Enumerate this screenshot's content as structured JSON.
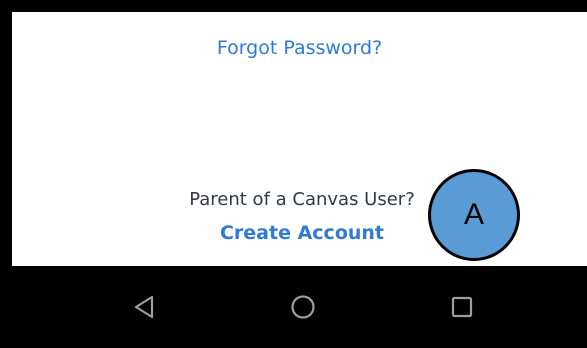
{
  "login": {
    "forgot_password": "Forgot Password?",
    "parent_prompt": "Parent of a Canvas User?",
    "create_account": "Create Account"
  },
  "annotation": {
    "marker_label": "A"
  },
  "navbar": {
    "back_icon": "back-triangle-icon",
    "home_icon": "home-circle-icon",
    "recents_icon": "recents-square-icon"
  },
  "colors": {
    "link": "#2d7bd6",
    "text": "#2d3b45",
    "marker_fill": "#5b9bd5",
    "navbar": "#000000",
    "nav_icons": "#9e9e9e"
  }
}
